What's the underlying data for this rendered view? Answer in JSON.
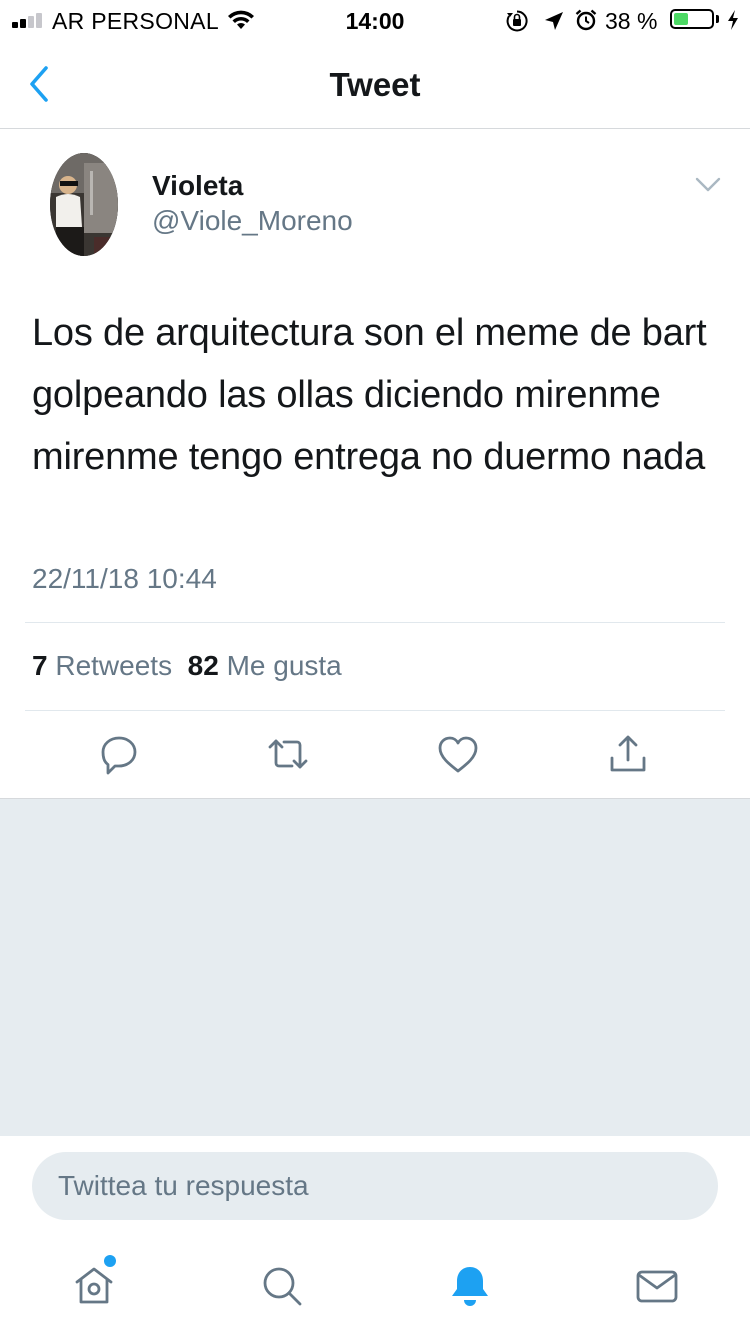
{
  "status_bar": {
    "carrier": "AR PERSONAL",
    "time": "14:00",
    "battery_percent": "38 %",
    "battery_level": 0.38,
    "signal_bars_active": 2,
    "icons": [
      "wifi-icon",
      "orientation-lock-icon",
      "location-arrow-icon",
      "alarm-icon",
      "charging-bolt-icon"
    ]
  },
  "nav": {
    "title": "Tweet",
    "back_icon": "chevron-left-icon"
  },
  "tweet": {
    "author_name": "Violeta",
    "author_handle": "@Viole_Moreno",
    "text": "Los de arquitectura son el meme de bart golpeando las ollas diciendo mirenme mirenme tengo entrega no duermo nada",
    "timestamp": "22/11/18 10:44",
    "retweets_count": "7",
    "retweets_label": "Retweets",
    "likes_count": "82",
    "likes_label": "Me gusta"
  },
  "actions": [
    "reply-icon",
    "retweet-icon",
    "like-icon",
    "share-icon"
  ],
  "reply": {
    "placeholder": "Twittea tu respuesta"
  },
  "tab_bar": {
    "items": [
      "home-icon",
      "search-icon",
      "notifications-icon",
      "messages-icon"
    ],
    "active": "notifications-icon",
    "home_has_unread_dot": true
  },
  "colors": {
    "accent": "#1da1f2",
    "text": "#14171a",
    "secondary_text": "#657786",
    "background_gray": "#e6ecf0",
    "battery_green": "#4cd964"
  }
}
